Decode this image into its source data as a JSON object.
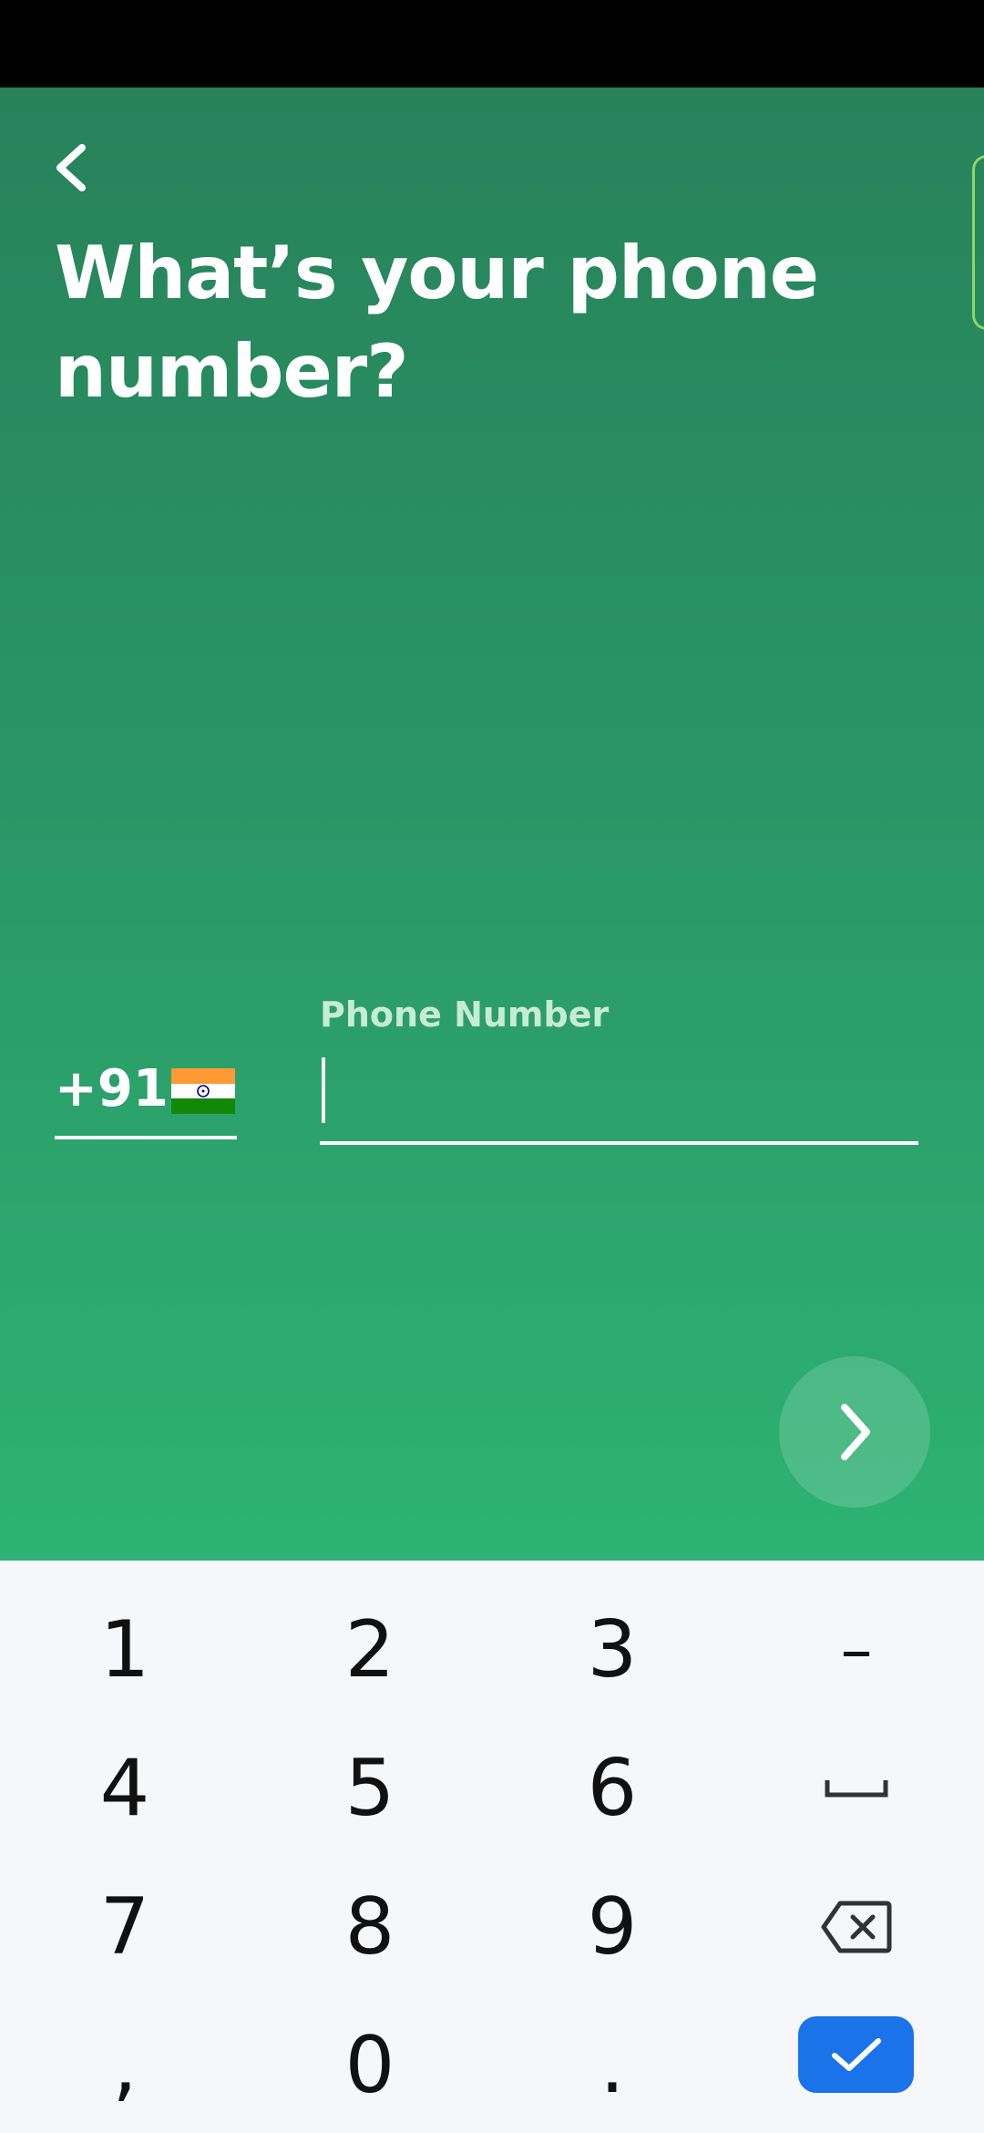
{
  "screen": {
    "title": "What’s your phone number?"
  },
  "country": {
    "code": "+91",
    "flag": "india-flag"
  },
  "phone": {
    "label": "Phone Number",
    "value": ""
  },
  "icons": {
    "back": "chevron-left-icon",
    "next": "chevron-right-icon",
    "backspace": "backspace-icon",
    "space": "space-bar-icon",
    "enter": "checkmark-icon"
  },
  "keyboard": {
    "rows": [
      [
        "1",
        "2",
        "3",
        "–"
      ],
      [
        "4",
        "5",
        "6",
        "space"
      ],
      [
        "7",
        "8",
        "9",
        "backspace"
      ],
      [
        ",",
        "0",
        ".",
        "enter"
      ]
    ]
  },
  "colors": {
    "gradient_top": "#27825a",
    "gradient_bottom": "#2db373",
    "keyboard_bg": "#f6f7f9",
    "enter_key": "#1a73e8"
  }
}
